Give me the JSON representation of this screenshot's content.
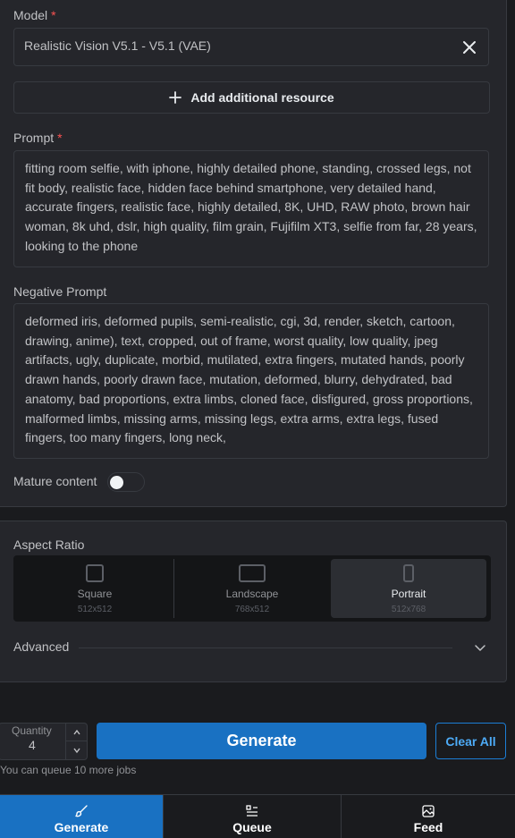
{
  "model": {
    "label": "Model",
    "required_mark": "*",
    "value": "Realistic Vision V5.1 - V5.1 (VAE)"
  },
  "add_resource_label": "Add additional resource",
  "prompt": {
    "label": "Prompt",
    "required_mark": "*",
    "value": "fitting room selfie, with iphone, highly detailed phone, standing, crossed legs, not fit body, realistic face, hidden face behind smartphone, very detailed hand, accurate fingers,  realistic face, highly detailed, 8K, UHD, RAW photo, brown hair woman, 8k uhd, dslr, high quality, film grain, Fujifilm XT3, selfie from far, 28 years, looking to the phone"
  },
  "negative_prompt": {
    "label": "Negative Prompt",
    "value": "deformed iris, deformed pupils, semi-realistic, cgi, 3d, render, sketch, cartoon, drawing, anime), text, cropped, out of frame, worst quality, low quality, jpeg artifacts, ugly, duplicate, morbid, mutilated, extra fingers, mutated hands, poorly drawn hands, poorly drawn face, mutation, deformed, blurry, dehydrated, bad anatomy, bad proportions, extra limbs, cloned face, disfigured, gross proportions, malformed limbs, missing arms, missing legs, extra arms, extra legs, fused fingers, too many fingers, long neck,"
  },
  "mature_content": {
    "label": "Mature content",
    "enabled": false
  },
  "aspect_ratio": {
    "label": "Aspect Ratio",
    "options": [
      {
        "title": "Square",
        "dims": "512x512",
        "active": false
      },
      {
        "title": "Landscape",
        "dims": "768x512",
        "active": false
      },
      {
        "title": "Portrait",
        "dims": "512x768",
        "active": true
      }
    ]
  },
  "advanced_label": "Advanced",
  "quantity": {
    "label": "Quantity",
    "value": "4"
  },
  "generate_label": "Generate",
  "clear_all_label": "Clear All",
  "queue_note": "You can queue 10 more jobs",
  "nav": [
    {
      "label": "Generate",
      "icon": "brush-icon",
      "active": true
    },
    {
      "label": "Queue",
      "icon": "list-icon",
      "active": false
    },
    {
      "label": "Feed",
      "icon": "photo-icon",
      "active": false
    }
  ],
  "colors": {
    "accent": "#1971c2",
    "required": "#fa5252",
    "panel": "#25262b",
    "background": "#1a1b1e"
  }
}
